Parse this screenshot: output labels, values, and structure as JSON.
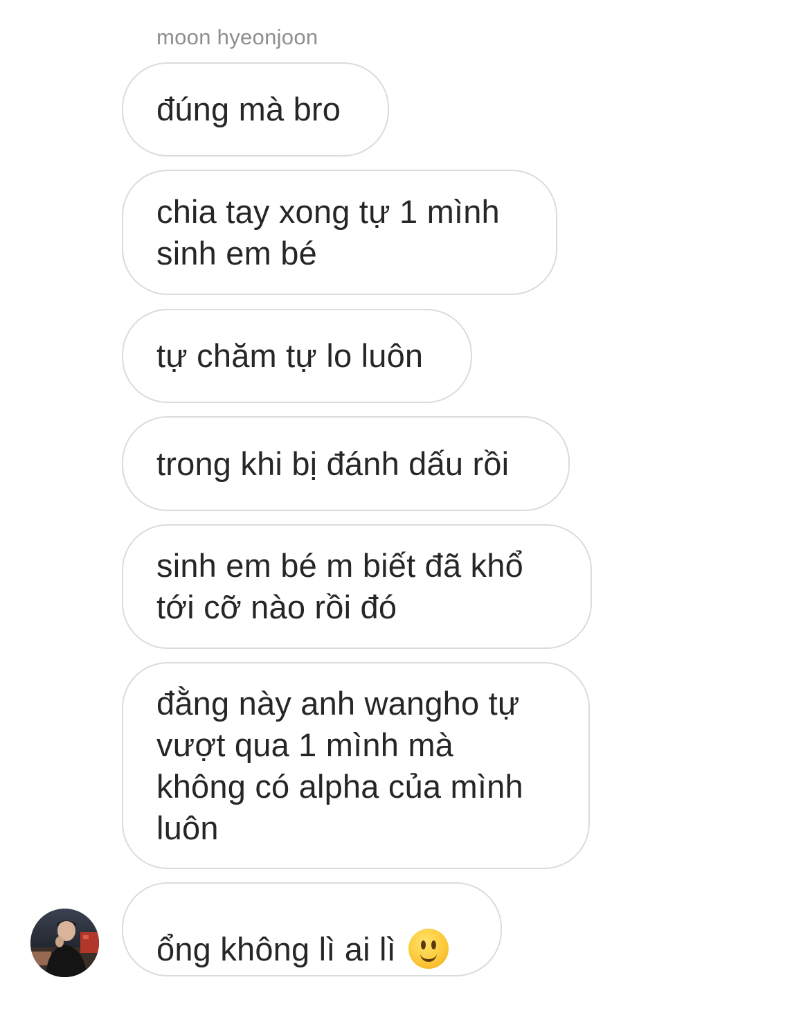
{
  "chat": {
    "sender_name": "moon hyeonjoon",
    "messages": [
      {
        "text": "đúng mà bro"
      },
      {
        "text": "chia tay xong tự 1 mình\nsinh em bé"
      },
      {
        "text": "tự chăm tự lo luôn"
      },
      {
        "text": "trong khi bị đánh dấu rồi"
      },
      {
        "text": "sinh em bé m biết đã khổ\ntới cỡ nào rồi đó"
      },
      {
        "text": "đằng này anh wangho tự\nvượt qua 1 mình mà\nkhông có alpha của mình\nluôn"
      },
      {
        "text": "ổng không lì ai lì",
        "emoji": "slightly-smiling-face-icon"
      }
    ],
    "avatar": "profile-photo"
  },
  "colors": {
    "background": "#ffffff",
    "bubble_border": "#dbdbdb",
    "text": "#262626",
    "sender_name": "#8e8e8e"
  }
}
